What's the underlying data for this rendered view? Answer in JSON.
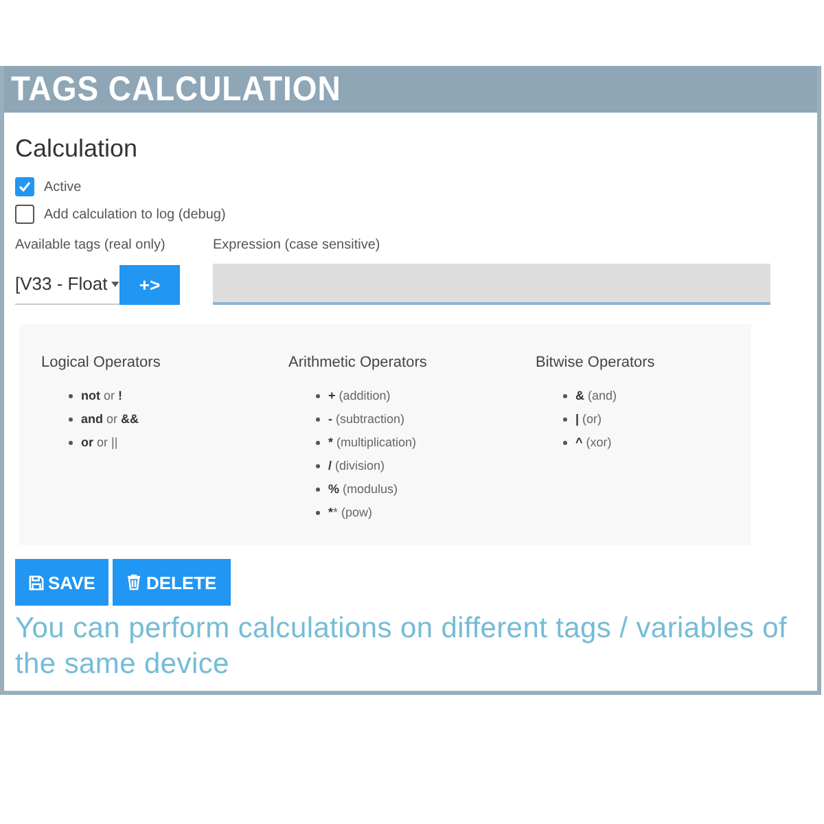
{
  "banner": {
    "title": "TAGS CALCULATION"
  },
  "section_title": "Calculation",
  "checkboxes": [
    {
      "label": "Active",
      "checked": true
    },
    {
      "label": "Add calculation to log (debug)",
      "checked": false
    }
  ],
  "tags": {
    "label": "Available tags (real only)",
    "value": "[V33 - Float",
    "add_button": "+>"
  },
  "expression": {
    "label": "Expression (case sensitive)"
  },
  "operator_groups": [
    {
      "title": "Logical Operators",
      "items": [
        "**not** or **!**",
        "**and** or **&&**",
        "**or** or ||"
      ]
    },
    {
      "title": "Arithmetic Operators",
      "items": [
        "**+** (addition)",
        "**-** (subtraction)",
        "***** (multiplication)",
        "**/** (division)",
        "**%** (modulus)",
        "****** (pow)"
      ]
    },
    {
      "title": "Bitwise Operators",
      "items": [
        "**&** (and)",
        "**|** (or)",
        "**^** (xor)"
      ]
    }
  ],
  "buttons": [
    {
      "kind": "save",
      "label": "SAVE"
    },
    {
      "kind": "delete",
      "label": "DELETE"
    }
  ],
  "caption": "You can perform calculations on different tags / variables of the same device"
}
